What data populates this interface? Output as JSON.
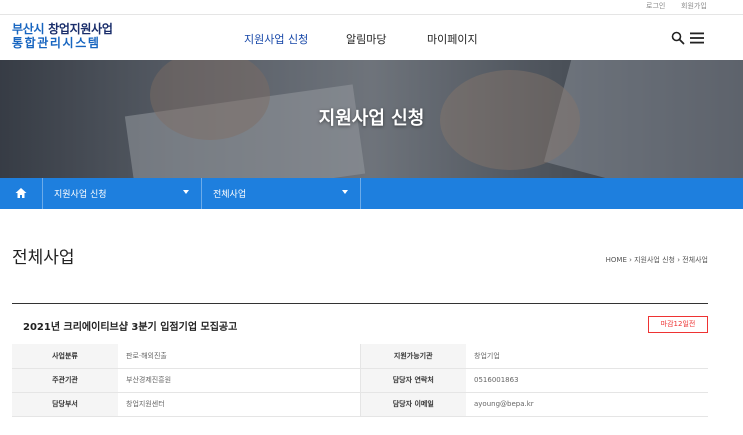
{
  "util": {
    "login": "로그인",
    "join": "회원가입"
  },
  "logo": {
    "line1_blue": "부산시",
    "line1_rest": " 창업지원사업",
    "line2": "통합관리시스템"
  },
  "nav": [
    {
      "label": "지원사업 신청"
    },
    {
      "label": "알림마당"
    },
    {
      "label": "마이페이지"
    }
  ],
  "banner": {
    "title": "지원사업 신청"
  },
  "subnav": {
    "level1": "지원사업 신청",
    "level2": "전체사업"
  },
  "page": {
    "title": "전체사업",
    "breadcrumb": "HOME  ›  지원사업 신청  ›  전체사업"
  },
  "notice": {
    "title": "2021년 크리에이티브샵 3분기 입점기업 모집공고",
    "deadline": "마감12일전",
    "rows": [
      {
        "k1": "사업분류",
        "v1": "판로·해외진출",
        "k2": "지원가능기관",
        "v2": "창업기업"
      },
      {
        "k1": "주관기관",
        "v1": "부산경제진흥원",
        "k2": "담당자 연락처",
        "v2": "0516001863"
      },
      {
        "k1": "담당부서",
        "v1": "창업지원센터",
        "k2": "담당자 이메일",
        "v2": "ayoung@bepa.kr"
      }
    ]
  },
  "colors": {
    "brand": "#1765c0",
    "subnav": "#1e7fde",
    "deadline": "#e33333"
  }
}
